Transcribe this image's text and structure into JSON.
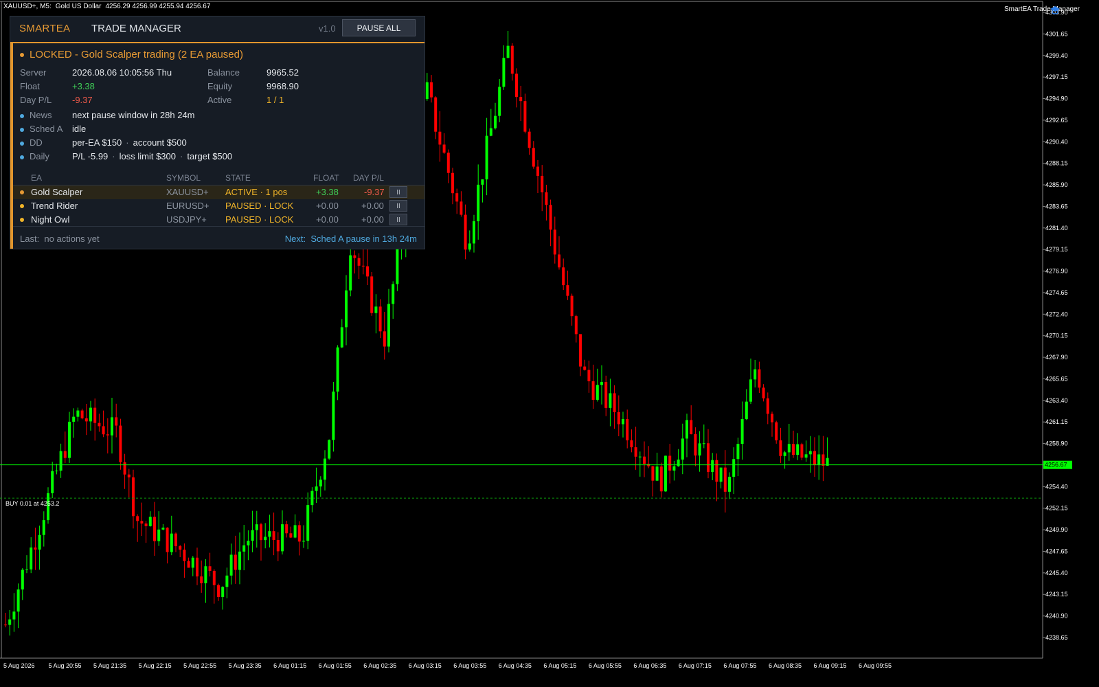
{
  "chart": {
    "symbol": "XAUUSD+, M5:",
    "description": "Gold US Dollar",
    "ohlc": "4256.29 4256.99 4255.94 4256.67",
    "indicator_label": "SmartEA Trade Manager",
    "current_price": "4256.67",
    "buy_label": "BUY 0.01 at 4253.2",
    "colors": {
      "bull": "#00ff00",
      "bear": "#ff0000",
      "grid_text": "#ffffff",
      "price_line": "#00ff00"
    },
    "price_ticks": [
      "4303.90",
      "4301.65",
      "4299.40",
      "4297.15",
      "4294.90",
      "4292.65",
      "4290.40",
      "4288.15",
      "4285.90",
      "4283.65",
      "4281.40",
      "4279.15",
      "4276.90",
      "4274.65",
      "4272.40",
      "4270.15",
      "4267.90",
      "4265.65",
      "4263.40",
      "4261.15",
      "4258.90",
      "4256.67",
      "4254.40",
      "4252.15",
      "4249.90",
      "4247.65",
      "4245.40",
      "4243.15",
      "4240.90",
      "4238.65"
    ],
    "time_ticks": [
      "5 Aug 2026",
      "5 Aug 20:55",
      "5 Aug 21:35",
      "5 Aug 22:15",
      "5 Aug 22:55",
      "5 Aug 23:35",
      "6 Aug 01:15",
      "6 Aug 01:55",
      "6 Aug 02:35",
      "6 Aug 03:15",
      "6 Aug 03:55",
      "6 Aug 04:35",
      "6 Aug 05:15",
      "6 Aug 05:55",
      "6 Aug 06:35",
      "6 Aug 07:15",
      "6 Aug 07:55",
      "6 Aug 08:35",
      "6 Aug 09:15",
      "6 Aug 09:55"
    ]
  },
  "panel": {
    "brand": "SMARTEA",
    "title": "TRADE MANAGER",
    "version": "v1.0",
    "pause_all": "PAUSE ALL",
    "status": "LOCKED - Gold Scalper trading  (2 EA paused)",
    "server_label": "Server",
    "server_value": "2026.08.06 10:05:56 Thu",
    "balance_label": "Balance",
    "balance_value": "9965.52",
    "float_label": "Float",
    "float_value": "+3.38",
    "equity_label": "Equity",
    "equity_value": "9968.90",
    "daypl_label": "Day P/L",
    "daypl_value": "-9.37",
    "active_label": "Active",
    "active_value": "1 / 1",
    "news_label": "News",
    "news_value": "next pause window in 28h 24m",
    "sched_label": "Sched A",
    "sched_value": "idle",
    "dd_label": "DD",
    "dd_a": "per-EA $150",
    "dd_b": "account $500",
    "daily_label": "Daily",
    "daily_a": "P/L -5.99",
    "daily_b": "loss limit $300",
    "daily_c": "target $500",
    "sep": "·",
    "columns": {
      "ea": "EA",
      "symbol": "SYMBOL",
      "state": "STATE",
      "float": "FLOAT",
      "daypl": "DAY P/L"
    },
    "rows": [
      {
        "ea": "Gold Scalper",
        "symbol": "XAUUSD+",
        "state": "ACTIVE · 1 pos",
        "float": "+3.38",
        "daypl": "-9.37",
        "btn": "II"
      },
      {
        "ea": "Trend Rider",
        "symbol": "EURUSD+",
        "state": "PAUSED · LOCK",
        "float": "+0.00",
        "daypl": "+0.00",
        "btn": "II"
      },
      {
        "ea": "Night Owl",
        "symbol": "USDJPY+",
        "state": "PAUSED · LOCK",
        "float": "+0.00",
        "daypl": "+0.00",
        "btn": "II"
      }
    ],
    "last_label": "Last:",
    "last_value": "no actions yet",
    "next_label": "Next:",
    "next_value": "Sched A pause in 13h 24m",
    "colors": {
      "accent": "#e2962d",
      "positive": "#3fce57",
      "negative": "#ef5a4a",
      "warn": "#f0b429",
      "info": "#4fa9df",
      "bg": "#161c25"
    }
  }
}
